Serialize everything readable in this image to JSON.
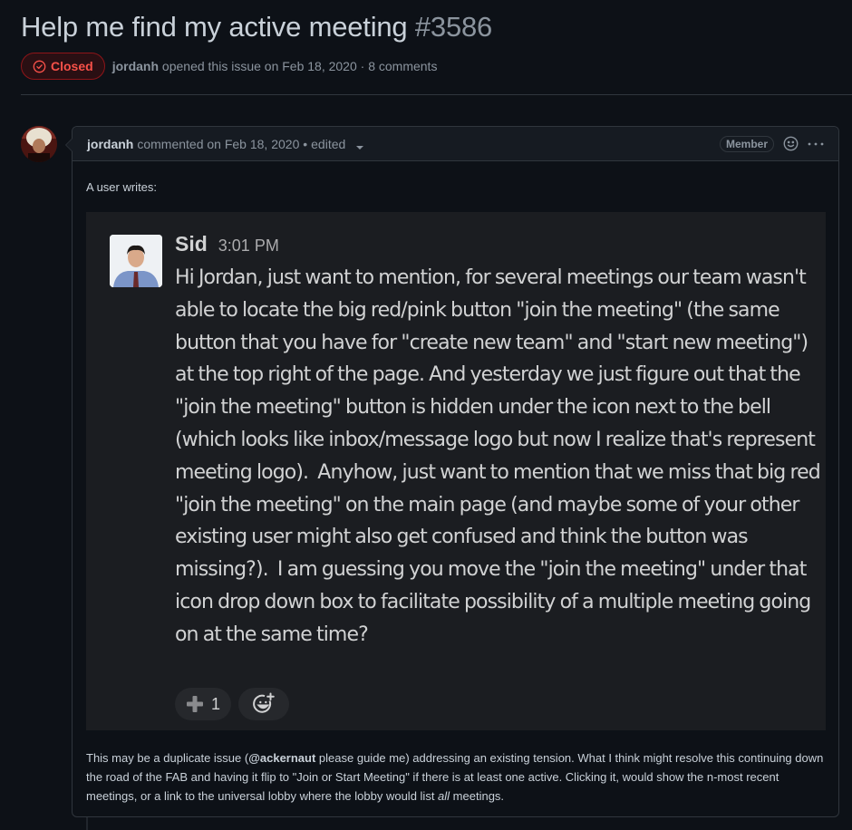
{
  "issue": {
    "title": "Help me find my active meeting",
    "number": "#3586",
    "state": "Closed",
    "state_icon": "check-circle-icon",
    "author": "jordanh",
    "opened_text": "opened this issue on Feb 18, 2020 · 8 comments"
  },
  "colors": {
    "closed": "#f85149",
    "background": "#0d1117",
    "border": "#30363d"
  },
  "comment": {
    "author": "jordanh",
    "action_text": "commented on Feb 18, 2020 •",
    "edited_label": "edited",
    "role_badge": "Member",
    "emoji_icon": "smiley-icon",
    "more_icon": "kebab-horizontal-icon",
    "intro": "A user writes:",
    "quote": {
      "name": "Sid",
      "time": "3:01 PM",
      "text": "Hi Jordan, just want to mention, for several meetings our team wasn't able to locate the big red/pink button \"join the meeting\" (the same button that you have for \"create new team\" and \"start new meeting\") at the top right of the page. And yesterday we just figure out that the \"join the meeting\" button is hidden under the icon next to the bell (which looks like inbox/message logo but now I realize that's represent meeting logo).  Anyhow, just want to mention that we miss that big red \"join the meeting\" on the main page (and maybe some of your other existing user might also get confused and think the button was missing?).  I am guessing you move the \"join the meeting\" under that icon drop down box to facilitate possibility of a multiple meeting going on at the same time?",
      "reactions": [
        {
          "icon": "heavy-plus-icon",
          "count": "1"
        }
      ],
      "add_reaction_icon": "add-reaction-icon"
    },
    "footer": {
      "part1": "This may be a duplicate issue (",
      "mention": "@ackernaut",
      "part2": " please guide me) addressing an existing tension. What I think might resolve this continuing down the road of the FAB and having it flip to \"Join or Start Meeting\" if there is at least one active. Clicking it, would show the n-most recent meetings, or a link to the universal lobby where the lobby would list ",
      "emphasis": "all",
      "part3": " meetings."
    }
  }
}
